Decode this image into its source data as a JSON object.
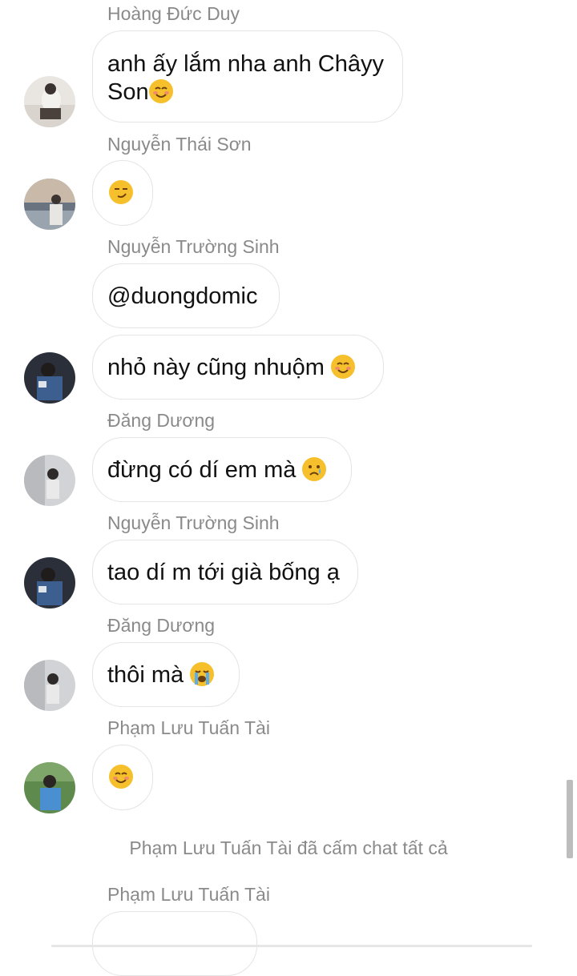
{
  "messages": [
    {
      "sender": "Hoàng Đức Duy",
      "text": "anh ấy lắm nha anh Châyy Son",
      "emoji": "smiling-blush"
    },
    {
      "sender": "Nguyễn Thái Sơn",
      "text": "",
      "emoji": "smirk"
    },
    {
      "sender": "Nguyễn Trường Sinh",
      "text": "@duongdomic",
      "emoji": ""
    },
    {
      "sender": "",
      "text": "nhỏ này cũng nhuộm ",
      "emoji": "smiling-blush"
    },
    {
      "sender": "Đăng Dương",
      "text": "đừng có dí em mà ",
      "emoji": "crying"
    },
    {
      "sender": "Nguyễn Trường Sinh",
      "text": "tao dí m tới già bống ạ",
      "emoji": ""
    },
    {
      "sender": "Đăng Dương",
      "text": "thôi mà ",
      "emoji": "loudly-crying"
    },
    {
      "sender": "Phạm Lưu Tuấn Tài",
      "text": "",
      "emoji": "smiling-blush"
    }
  ],
  "system_message": "Phạm Lưu Tuấn Tài đã cấm chat tất cả",
  "last_sender": "Phạm Lưu Tuấn Tài",
  "first_line": "anh ấy lắm nha anh Châyy",
  "first_line2": "Son",
  "colors": {
    "emoji": "#f5c02c",
    "sender": "#8a8a8a",
    "bubble_border": "#e4e4e4"
  }
}
